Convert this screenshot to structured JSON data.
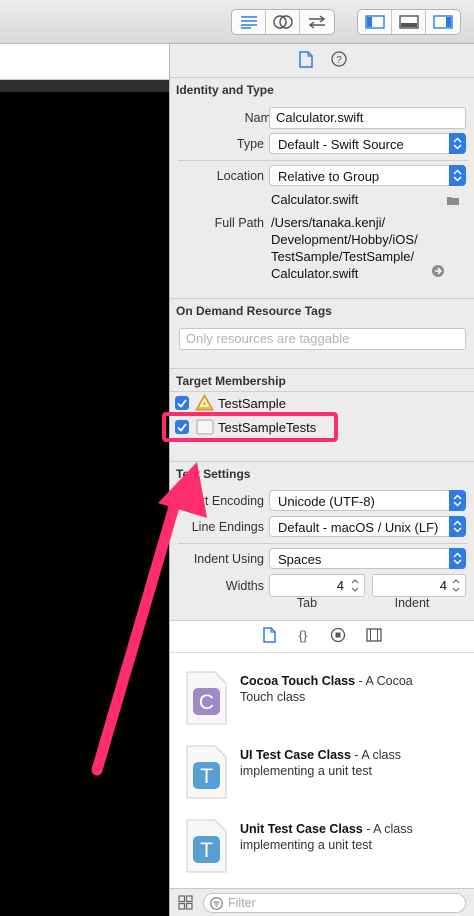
{
  "identity": {
    "heading": "Identity and Type",
    "name_label": "Name",
    "name_value": "Calculator.swift",
    "type_label": "Type",
    "type_value": "Default - Swift Source",
    "location_label": "Location",
    "location_value": "Relative to Group",
    "location_file": "Calculator.swift",
    "full_path_label": "Full Path",
    "full_path_lines": [
      "/Users/tanaka.kenji/",
      "Development/Hobby/iOS/",
      "TestSample/TestSample/",
      "Calculator.swift"
    ]
  },
  "on_demand": {
    "heading": "On Demand Resource Tags",
    "placeholder": "Only resources are taggable"
  },
  "target_membership": {
    "heading": "Target Membership",
    "targets": [
      {
        "label": "TestSample",
        "checked": true
      },
      {
        "label": "TestSampleTests",
        "checked": true
      }
    ]
  },
  "text_settings": {
    "heading": "Text Settings",
    "encoding_label": "Text Encoding",
    "encoding_value": "Unicode (UTF-8)",
    "line_endings_label": "Line Endings",
    "line_endings_value": "Default - macOS / Unix (LF)",
    "indent_using_label": "Indent Using",
    "indent_using_value": "Spaces",
    "widths_label": "Widths",
    "tab_value": "4",
    "indent_value": "4",
    "tab_label": "Tab",
    "indent_label": "Indent"
  },
  "library": {
    "items": [
      {
        "icon_letter": "C",
        "title": "Cocoa Touch Class",
        "description_line1": " - A Cocoa",
        "description_line2": "Touch class",
        "color": "#9b8bc6"
      },
      {
        "icon_letter": "T",
        "title": "UI Test Case Class",
        "description_line1": " - A class",
        "description_line2": "implementing a unit test",
        "color": "#5a9fd4"
      },
      {
        "icon_letter": "T",
        "title": "Unit Test Case Class",
        "description_line1": " - A class",
        "description_line2": "implementing a unit test",
        "color": "#5a9fd4"
      }
    ],
    "filter_placeholder": "Filter"
  },
  "colors": {
    "accent": "#2f7be6",
    "annotation": "#ff2d6e"
  }
}
